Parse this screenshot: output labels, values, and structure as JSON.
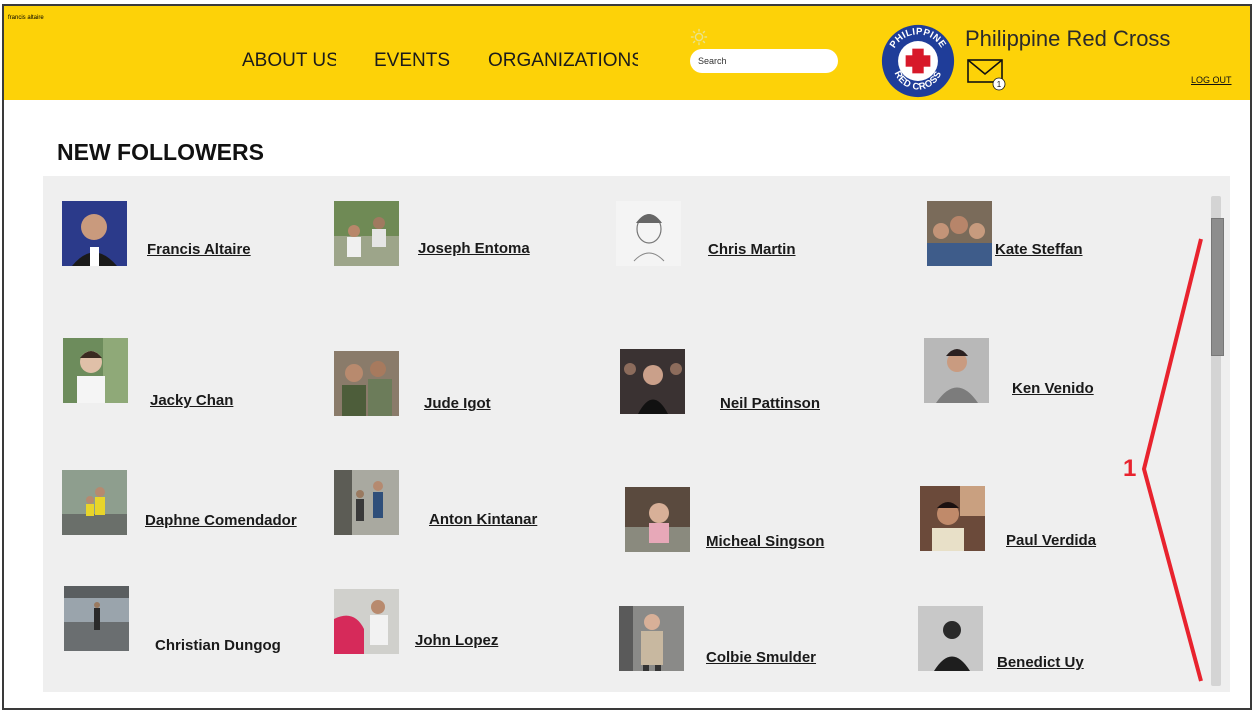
{
  "header": {
    "user_tiny": "francis altaire",
    "nav": [
      "ABOUT US",
      "EVENTS",
      "ORGANIZATIONS"
    ],
    "search_placeholder": "Search",
    "org_name": "Philippine Red Cross",
    "mail_badge": "1",
    "logout": "LOG OUT",
    "logo_text_top": "PHILIPPINE",
    "logo_text_bottom": "RED CROSS"
  },
  "page_title": "NEW FOLLOWERS",
  "followers": [
    "Francis Altaire",
    "Joseph Entoma",
    "Chris Martin",
    "Kate Steffan",
    "Jacky Chan",
    "Jude Igot",
    "Neil Pattinson",
    "Ken Venido",
    "Daphne Comendador",
    "Anton Kintanar",
    "Micheal Singson",
    "Paul Verdida",
    "Christian  Dungog",
    "John Lopez",
    "Colbie  Smulder",
    "Benedict Uy"
  ],
  "annotation_label": "1",
  "colors": {
    "header_bg": "#fdd208",
    "panel_bg": "#efefef",
    "annotation": "#e8232e",
    "logo_blue": "#1f3d99",
    "logo_red": "#d7192a"
  }
}
